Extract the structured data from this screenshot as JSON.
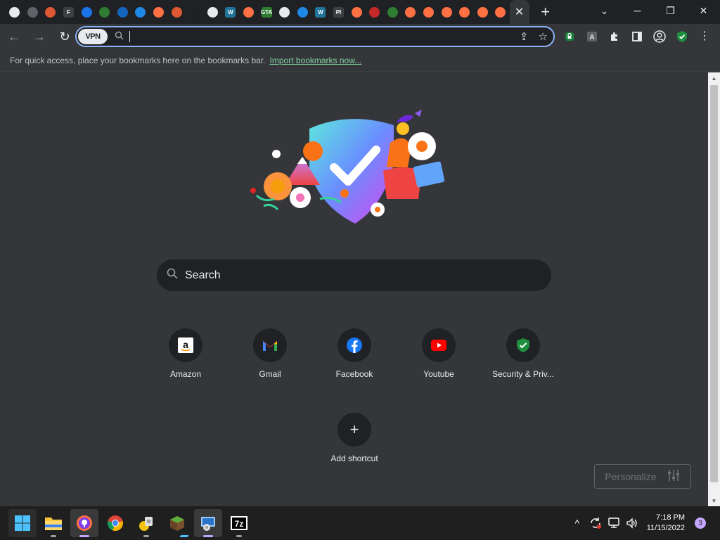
{
  "tabs": {
    "favicons": [
      {
        "name": "web-globe-icon",
        "color": "#e8eaed",
        "text": ""
      },
      {
        "name": "shopping-cart-icon",
        "color": "#5f6368",
        "text": ""
      },
      {
        "name": "duckduckgo-icon",
        "color": "#de5833",
        "text": ""
      },
      {
        "name": "f-letter-icon",
        "color": "#3c4043",
        "text": "F"
      },
      {
        "name": "outlook-icon",
        "color": "#1a73e8",
        "text": ""
      },
      {
        "name": "download-icon",
        "color": "#2e7d32",
        "text": ""
      },
      {
        "name": "blue-doc-icon",
        "color": "#1565c0",
        "text": ""
      },
      {
        "name": "malwarebytes-icon",
        "color": "#1e88e5",
        "text": ""
      },
      {
        "name": "avast-browser-icon",
        "color": "#ff7043",
        "text": ""
      },
      {
        "name": "duckduckgo-icon",
        "color": "#de5833",
        "text": ""
      },
      {
        "name": "loading-spinner-icon",
        "color": "#202124",
        "text": ""
      },
      {
        "name": "web-globe-icon",
        "color": "#e8eaed",
        "text": ""
      },
      {
        "name": "wordpress-icon",
        "color": "#21759b",
        "text": "W"
      },
      {
        "name": "avast-browser-icon",
        "color": "#ff7043",
        "text": ""
      },
      {
        "name": "gta-icon",
        "color": "#2e7d32",
        "text": "GTA"
      },
      {
        "name": "web-globe-icon",
        "color": "#e8eaed",
        "text": ""
      },
      {
        "name": "windscribe-icon",
        "color": "#1e88e5",
        "text": ""
      },
      {
        "name": "wordpress-icon",
        "color": "#21759b",
        "text": "W"
      },
      {
        "name": "pi-icon",
        "color": "#3c4043",
        "text": "PI"
      },
      {
        "name": "avast-browser-icon",
        "color": "#ff7043",
        "text": ""
      },
      {
        "name": "red-circle-icon",
        "color": "#c62828",
        "text": ""
      },
      {
        "name": "green-shield-icon",
        "color": "#2e7d32",
        "text": ""
      },
      {
        "name": "avast-browser-icon",
        "color": "#ff7043",
        "text": ""
      },
      {
        "name": "avast-browser-icon",
        "color": "#ff7043",
        "text": ""
      },
      {
        "name": "avast-browser-icon",
        "color": "#ff7043",
        "text": ""
      },
      {
        "name": "avast-browser-icon",
        "color": "#ff7043",
        "text": ""
      },
      {
        "name": "avast-browser-icon",
        "color": "#ff7043",
        "text": ""
      },
      {
        "name": "avast-browser-icon",
        "color": "#ff7043",
        "text": ""
      }
    ]
  },
  "omnibox": {
    "vpn_label": "VPN"
  },
  "bookmarks_bar": {
    "message": "For quick access, place your bookmarks here on the bookmarks bar.",
    "import_link": "Import bookmarks now..."
  },
  "ntp": {
    "search_placeholder": "Search",
    "shortcuts": [
      {
        "label": "Amazon",
        "icon": "amazon-icon"
      },
      {
        "label": "Gmail",
        "icon": "gmail-icon"
      },
      {
        "label": "Facebook",
        "icon": "facebook-icon"
      },
      {
        "label": "Youtube",
        "icon": "youtube-icon"
      },
      {
        "label": "Security & Priv...",
        "icon": "shield-check-icon"
      }
    ],
    "add_shortcut": "Add shortcut",
    "personalize": "Personalize"
  },
  "taskbar": {
    "time": "7:18 PM",
    "date": "11/15/2022",
    "notification_count": "3"
  }
}
